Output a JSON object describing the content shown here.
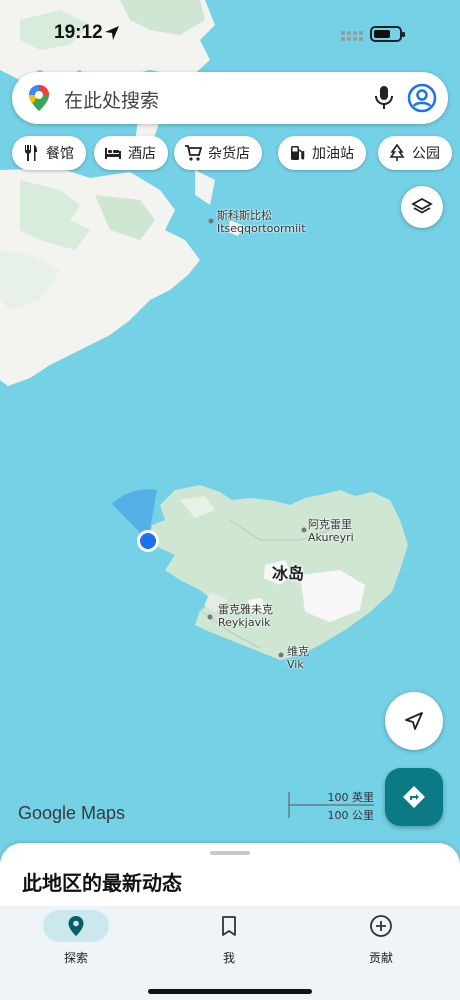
{
  "status_bar": {
    "time": "19:12"
  },
  "search": {
    "placeholder": "在此处搜索"
  },
  "chips": [
    {
      "label": "餐馆",
      "icon": "fork-knife-icon"
    },
    {
      "label": "酒店",
      "icon": "bed-icon"
    },
    {
      "label": "杂货店",
      "icon": "shopping-cart-icon"
    },
    {
      "label": "加油站",
      "icon": "gas-station-icon"
    },
    {
      "label": "公园",
      "icon": "tree-icon"
    }
  ],
  "map": {
    "labels": {
      "itseqqortoormiit_cn": "斯科斯比松",
      "itseqqortoormiit": "Itseqqortoormiit",
      "akureyri_cn": "阿克雷里",
      "akureyri": "Akureyri",
      "iceland": "冰岛",
      "reykjavik_cn": "雷克雅未克",
      "reykjavik": "Reykjavik",
      "vik_cn": "维克",
      "vik": "Vik"
    },
    "watermark": "Google Maps",
    "scale": {
      "miles": "100 英里",
      "km": "100 公里"
    }
  },
  "sheet": {
    "title": "此地区的最新动态"
  },
  "bottom_nav": {
    "tabs": [
      {
        "label": "探索",
        "icon": "location-pin-icon",
        "active": true
      },
      {
        "label": "我",
        "icon": "bookmark-icon",
        "active": false
      },
      {
        "label": "贡献",
        "icon": "add-circle-icon",
        "active": false
      }
    ]
  },
  "colors": {
    "water": "#75d1e6",
    "land": "#f3f3f0",
    "green": "#cfe7d2",
    "accent": "#0b7a84",
    "location_dot": "#1a73e8"
  }
}
